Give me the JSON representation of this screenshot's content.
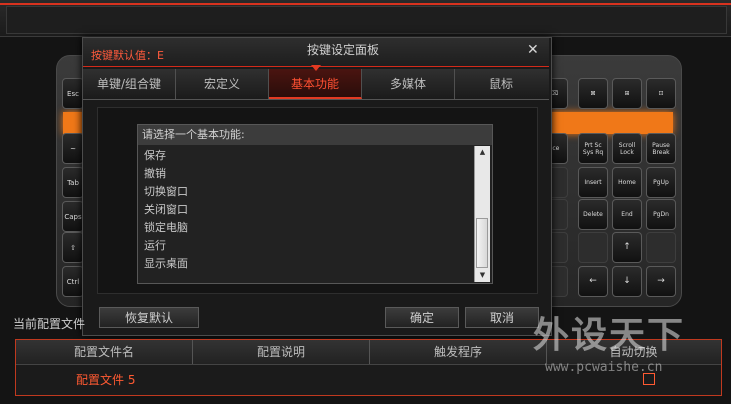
{
  "dialog": {
    "default_value_label": "按键默认值：E",
    "title": "按键设定面板",
    "close_glyph": "✕",
    "tabs": [
      "单键/组合键",
      "宏定义",
      "基本功能",
      "多媒体",
      "鼠标"
    ],
    "active_tab": "基本功能",
    "list": {
      "header": "请选择一个基本功能:",
      "items": [
        "保存",
        "撤销",
        "切换窗口",
        "关闭窗口",
        "锁定电脑",
        "运行",
        "显示桌面"
      ]
    },
    "restore_default_label": "恢复默认",
    "ok_label": "确定",
    "cancel_label": "取消"
  },
  "keyboard": {
    "left_keys": [
      "Esc",
      "~",
      "Tab",
      "Caps",
      "⇧",
      "Ctrl"
    ],
    "right_keys": {
      "row0": [
        "⌫",
        "⊠",
        "⊞",
        "⊡"
      ],
      "row1": [
        "ace",
        "Prt Sc\nSys Rq",
        "Scroll\nLock",
        "Pause\nBreak"
      ],
      "row2": [
        "",
        "Insert",
        "Home",
        "PgUp"
      ],
      "row3": [
        "",
        "Delete",
        "End",
        "PgDn"
      ],
      "row4": [
        "",
        "",
        "↑",
        ""
      ],
      "row5": [
        "",
        "←",
        "↓",
        "→"
      ]
    }
  },
  "config": {
    "current_label": "当前配置文件",
    "columns": [
      "配置文件名",
      "配置说明",
      "触发程序",
      "自动切换"
    ],
    "rows": [
      {
        "name": "配置文件 5"
      }
    ]
  },
  "watermark": {
    "text": "外设天下",
    "url": "www.pcwaishe.cn"
  },
  "colors": {
    "accent_red": "#e23a22",
    "orange_bar": "#f07818"
  }
}
